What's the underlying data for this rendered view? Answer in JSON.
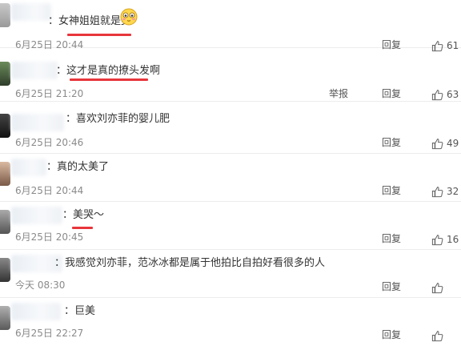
{
  "comments": [
    {
      "text": "：女神姐姐就是美",
      "time": "6月25日 20:44",
      "reply": "回复",
      "likes": "61",
      "report": ""
    },
    {
      "text": "：这才是真的撩头发啊",
      "time": "6月25日 21:20",
      "reply": "回复",
      "likes": "63",
      "report": "举报"
    },
    {
      "text": "：喜欢刘亦菲的婴儿肥",
      "time": "6月25日 20:46",
      "reply": "回复",
      "likes": "49",
      "report": ""
    },
    {
      "text": "：真的太美了",
      "time": "6月25日 20:44",
      "reply": "回复",
      "likes": "32",
      "report": ""
    },
    {
      "text": "：美哭～",
      "time": "6月25日 20:45",
      "reply": "回复",
      "likes": "16",
      "report": ""
    },
    {
      "text": "：我感觉刘亦菲，范冰冰都是属于他拍比自拍好看很多的人",
      "time": "今天 08:30",
      "reply": "回复",
      "likes": "",
      "report": ""
    },
    {
      "text": "：巨美",
      "time": "6月25日 22:27",
      "reply": "回复",
      "likes": "",
      "report": ""
    }
  ],
  "colors": {
    "underline": "#e8353b",
    "divider": "#ececec"
  },
  "icons": {
    "like": "thumbs-up-icon",
    "emoji": "blush-face-emoji"
  }
}
